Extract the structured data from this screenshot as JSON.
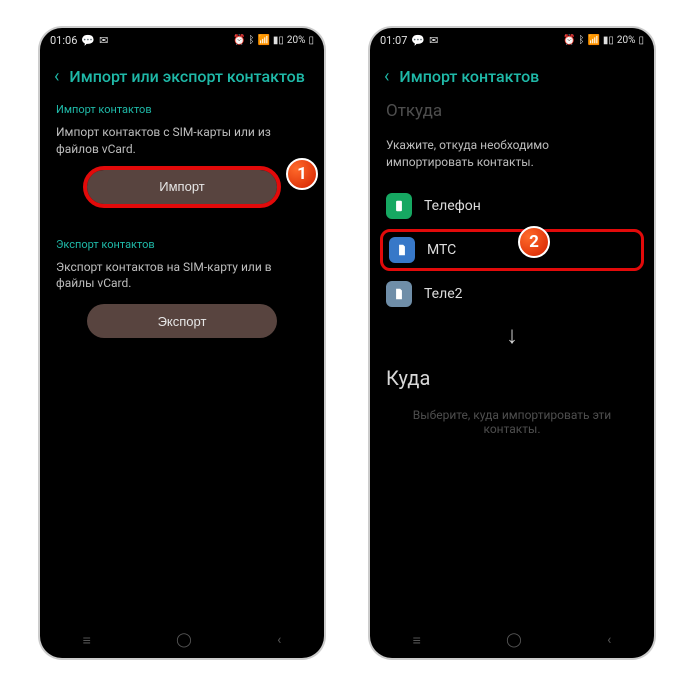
{
  "left": {
    "status": {
      "time": "01:06",
      "battery": "20%"
    },
    "title": "Импорт или экспорт контактов",
    "import_section": "Импорт контактов",
    "import_desc": "Импорт контактов с SIM-карты или из файлов vCard.",
    "import_btn": "Импорт",
    "export_section": "Экспорт контактов",
    "export_desc": "Экспорт контактов на SIM-карту или в файлы vCard.",
    "export_btn": "Экспорт",
    "badge": "1"
  },
  "right": {
    "status": {
      "time": "01:07",
      "battery": "20%"
    },
    "title": "Импорт контактов",
    "from_label": "Откуда",
    "info": "Укажите, откуда необходимо импортировать контакты.",
    "opts": [
      {
        "label": "Телефон"
      },
      {
        "label": "МТС"
      },
      {
        "label": "Теле2"
      }
    ],
    "to_label": "Куда",
    "hint": "Выберите, куда импортировать эти контакты.",
    "badge": "2"
  }
}
